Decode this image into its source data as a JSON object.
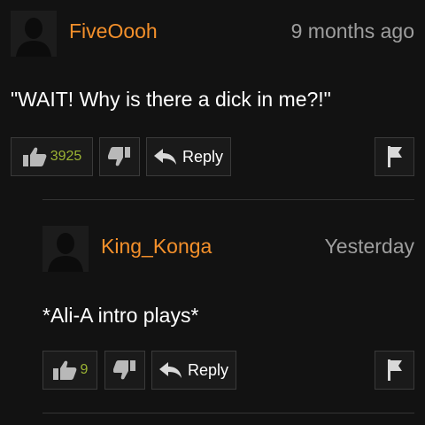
{
  "comments": [
    {
      "username": "FiveOooh",
      "time": "9 months ago",
      "text": "\"WAIT! Why is there a dick in me?!\"",
      "likes": "3925",
      "reply_label": "Reply"
    },
    {
      "username": "King_Konga",
      "time": "Yesterday",
      "text": "*Ali-A intro plays*",
      "likes": "9",
      "reply_label": "Reply"
    }
  ],
  "colors": {
    "background": "#121212",
    "username": "#f4902b",
    "timestamp": "#9e9e9e",
    "like_count": "#9bb333",
    "button_bg": "#1a1a1a",
    "button_border": "#3a3a3a"
  },
  "icons": [
    "avatar-silhouette",
    "thumbs-up-icon",
    "thumbs-down-icon",
    "reply-arrow-icon",
    "flag-icon"
  ]
}
